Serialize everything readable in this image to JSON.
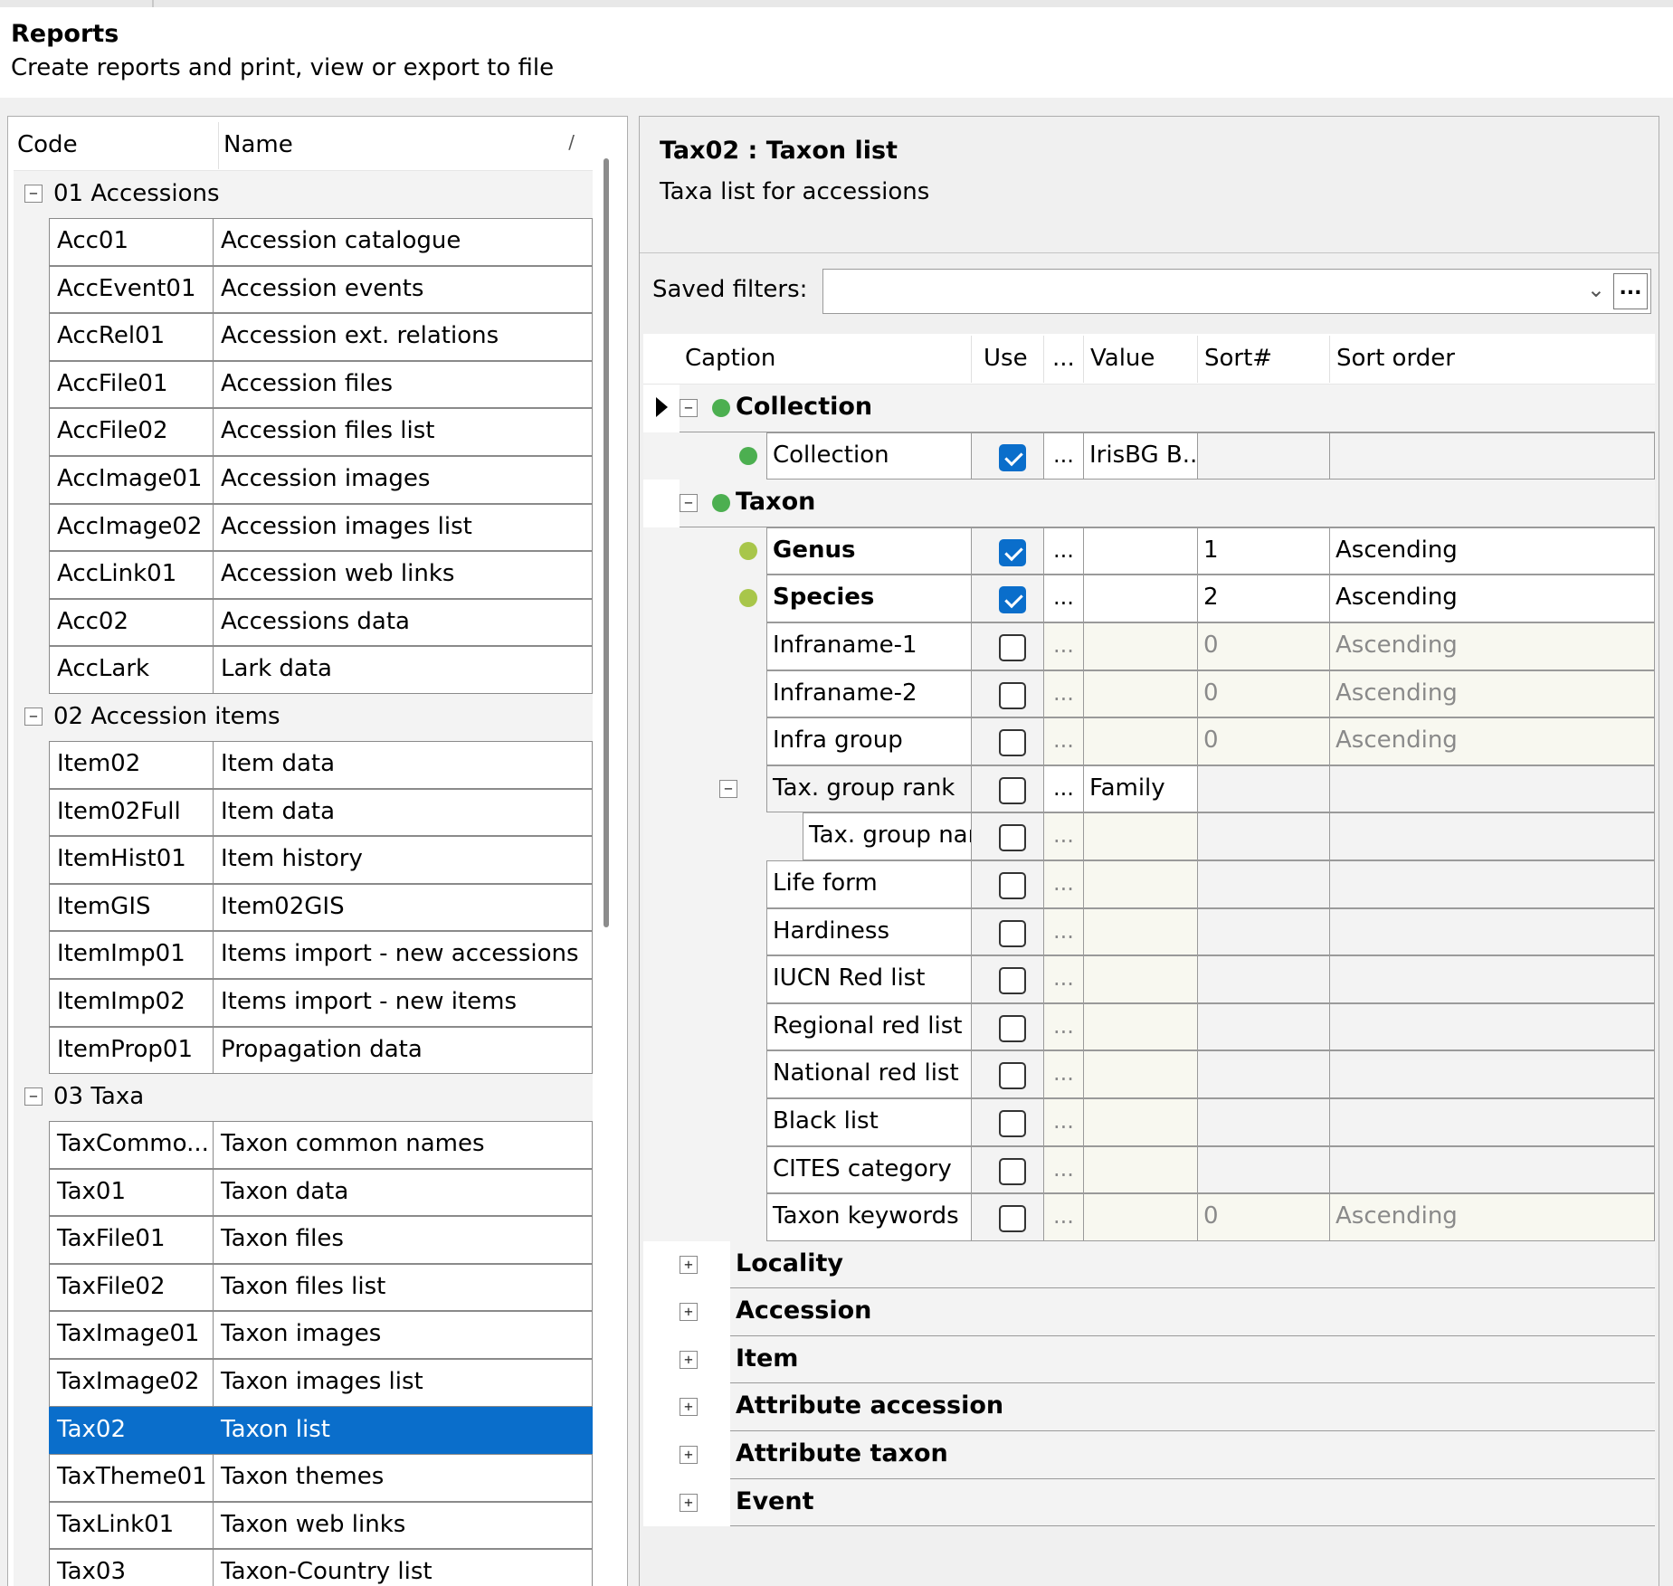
{
  "header": {
    "title": "Reports",
    "subtitle": "Create reports and print, view or export to file"
  },
  "report_list": {
    "columns": {
      "code": "Code",
      "name": "Name"
    },
    "groups": [
      {
        "label": "01 Accessions",
        "rows": [
          {
            "code": "Acc01",
            "name": "Accession catalogue"
          },
          {
            "code": "AccEvent01",
            "name": "Accession events"
          },
          {
            "code": "AccRel01",
            "name": "Accession ext. relations"
          },
          {
            "code": "AccFile01",
            "name": "Accession files"
          },
          {
            "code": "AccFile02",
            "name": "Accession files list"
          },
          {
            "code": "AccImage01",
            "name": "Accession images"
          },
          {
            "code": "AccImage02",
            "name": "Accession images list"
          },
          {
            "code": "AccLink01",
            "name": "Accession web links"
          },
          {
            "code": "Acc02",
            "name": "Accessions data"
          },
          {
            "code": "AccLark",
            "name": "Lark data"
          }
        ]
      },
      {
        "label": "02 Accession items",
        "rows": [
          {
            "code": "Item02",
            "name": "Item data"
          },
          {
            "code": "Item02Full",
            "name": "Item data"
          },
          {
            "code": "ItemHist01",
            "name": "Item history"
          },
          {
            "code": "ItemGIS",
            "name": "Item02GIS"
          },
          {
            "code": "ItemImp01",
            "name": "Items import - new accessions"
          },
          {
            "code": "ItemImp02",
            "name": "Items import - new items"
          },
          {
            "code": "ItemProp01",
            "name": "Propagation data"
          }
        ]
      },
      {
        "label": "03 Taxa",
        "rows": [
          {
            "code": "TaxCommo...",
            "name": "Taxon common names"
          },
          {
            "code": "Tax01",
            "name": "Taxon data"
          },
          {
            "code": "TaxFile01",
            "name": "Taxon files"
          },
          {
            "code": "TaxFile02",
            "name": "Taxon files list"
          },
          {
            "code": "TaxImage01",
            "name": "Taxon images"
          },
          {
            "code": "TaxImage02",
            "name": "Taxon images list"
          },
          {
            "code": "Tax02",
            "name": "Taxon list",
            "selected": true
          },
          {
            "code": "TaxTheme01",
            "name": "Taxon themes"
          },
          {
            "code": "TaxLink01",
            "name": "Taxon web links"
          },
          {
            "code": "Tax03",
            "name": "Taxon-Country list"
          }
        ]
      }
    ]
  },
  "detail": {
    "title": "Tax02 : Taxon list",
    "description": "Taxa list for accessions",
    "saved_filters_label": "Saved filters:",
    "saved_filters_value": "",
    "saved_filters_button": "...",
    "columns": {
      "caption": "Caption",
      "use": "Use",
      "dots": "...",
      "value": "Value",
      "sort_num": "Sort#",
      "sort_order": "Sort order"
    },
    "collection_group": {
      "label": "Collection",
      "field": {
        "caption": "Collection",
        "use": true,
        "ellipsis": "...",
        "value": "IrisBG B...",
        "sort_num": "",
        "sort_order": ""
      }
    },
    "taxon_group": {
      "label": "Taxon",
      "fields": [
        {
          "caption": "Genus",
          "use": true,
          "ellipsis": "...",
          "value": "",
          "sort_num": "1",
          "sort_order": "Ascending",
          "bold": true,
          "dot": true
        },
        {
          "caption": "Species",
          "use": true,
          "ellipsis": "...",
          "value": "",
          "sort_num": "2",
          "sort_order": "Ascending",
          "bold": true,
          "dot": true
        },
        {
          "caption": "Infraname-1",
          "use": false,
          "ellipsis": "...",
          "value": "",
          "sort_num": "0",
          "sort_order": "Ascending"
        },
        {
          "caption": "Infraname-2",
          "use": false,
          "ellipsis": "...",
          "value": "",
          "sort_num": "0",
          "sort_order": "Ascending"
        },
        {
          "caption": "Infra group",
          "use": false,
          "ellipsis": "...",
          "value": "",
          "sort_num": "0",
          "sort_order": "Ascending"
        },
        {
          "caption": "Tax. group rank",
          "use": false,
          "ellipsis": "...",
          "value": "Family",
          "sort_num": "",
          "sort_order": ""
        },
        {
          "caption": "Tax. group name",
          "use": false,
          "ellipsis": "...",
          "value": "",
          "sort_num": "",
          "sort_order": ""
        },
        {
          "caption": "Life form",
          "use": false,
          "ellipsis": "...",
          "value": "",
          "sort_num": "",
          "sort_order": ""
        },
        {
          "caption": "Hardiness",
          "use": false,
          "ellipsis": "...",
          "value": "",
          "sort_num": "",
          "sort_order": ""
        },
        {
          "caption": "IUCN Red list",
          "use": false,
          "ellipsis": "...",
          "value": "",
          "sort_num": "",
          "sort_order": ""
        },
        {
          "caption": "Regional red list",
          "use": false,
          "ellipsis": "...",
          "value": "",
          "sort_num": "",
          "sort_order": ""
        },
        {
          "caption": "National red list",
          "use": false,
          "ellipsis": "...",
          "value": "",
          "sort_num": "",
          "sort_order": ""
        },
        {
          "caption": "Black list",
          "use": false,
          "ellipsis": "...",
          "value": "",
          "sort_num": "",
          "sort_order": ""
        },
        {
          "caption": "CITES category",
          "use": false,
          "ellipsis": "...",
          "value": "",
          "sort_num": "",
          "sort_order": ""
        },
        {
          "caption": "Taxon keywords",
          "use": false,
          "ellipsis": "...",
          "value": "",
          "sort_num": "0",
          "sort_order": "Ascending"
        }
      ]
    },
    "collapsed_groups": [
      "Locality",
      "Accession",
      "Item",
      "Attribute accession",
      "Attribute taxon",
      "Event"
    ]
  }
}
